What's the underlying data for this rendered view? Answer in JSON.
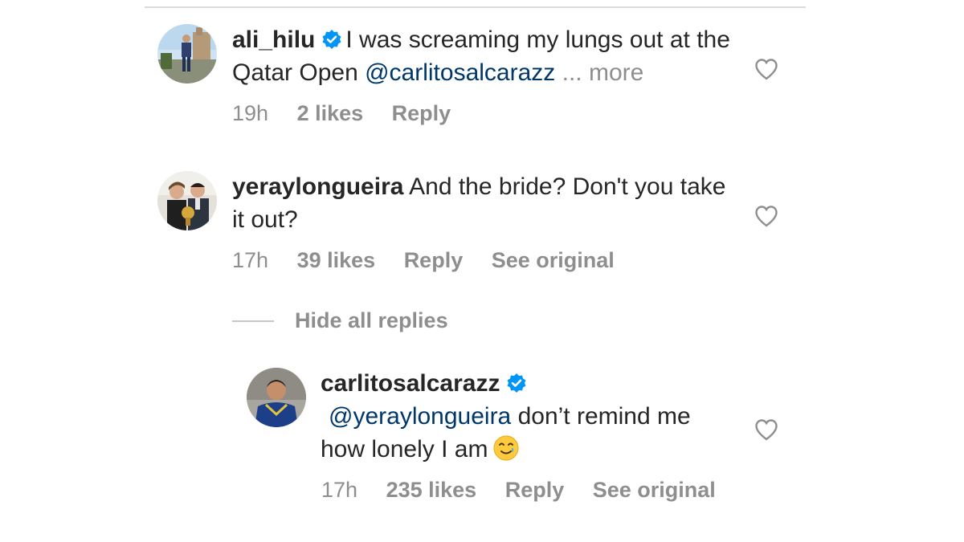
{
  "comments": [
    {
      "username": "ali_hilu",
      "verified": true,
      "text_before": "I was screaming my lungs out at the Qatar Open ",
      "mention": "@carlitosalcarazz",
      "more": "... more",
      "time": "19h",
      "likes": "2 likes",
      "reply": "Reply"
    },
    {
      "username": "yeraylongueira",
      "verified": false,
      "text": "And the bride? Don't you take it out?",
      "time": "17h",
      "likes": "39 likes",
      "reply": "Reply",
      "see_original": "See original"
    }
  ],
  "hide_replies": "Hide all replies",
  "reply_comment": {
    "username": "carlitosalcarazz",
    "verified": true,
    "mention": "@yeraylongueira",
    "text_after": " don’t remind me how lonely I am",
    "emoji": "smiling-face-with-tear",
    "time": "17h",
    "likes": "235 likes",
    "reply": "Reply",
    "see_original": "See original"
  },
  "colors": {
    "verified_blue": "#0095f6",
    "mention_blue": "#00376b",
    "secondary_text": "#8e8e8e"
  }
}
